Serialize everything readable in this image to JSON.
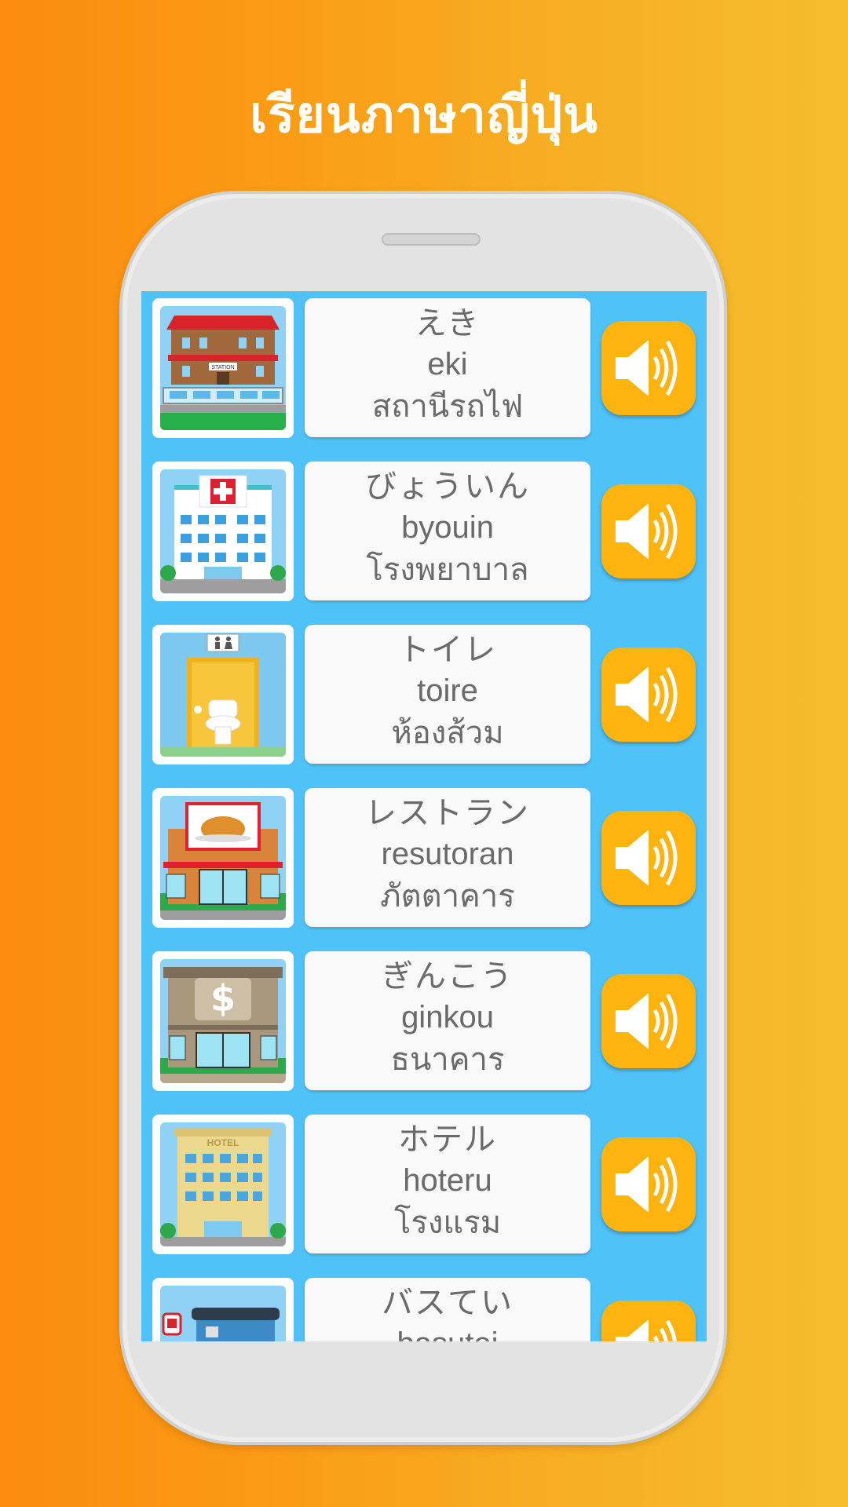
{
  "header": {
    "title": "เรียนภาษาญี่ปุ่น"
  },
  "colors": {
    "accent": "#ffb30f",
    "screen_bg": "#4fc2f7",
    "background": "#fb8c0e"
  },
  "words": [
    {
      "japanese": "えき",
      "romaji": "eki",
      "thai": "สถานีรถไฟ",
      "image": "train-station-icon",
      "sign": "STATION"
    },
    {
      "japanese": "びょういん",
      "romaji": "byouin",
      "thai": "โรงพยาบาล",
      "image": "hospital-icon"
    },
    {
      "japanese": "トイレ",
      "romaji": "toire",
      "thai": "ห้องส้วม",
      "image": "toilet-icon"
    },
    {
      "japanese": "レストラン",
      "romaji": "resutoran",
      "thai": "ภัตตาคาร",
      "image": "restaurant-icon"
    },
    {
      "japanese": "ぎんこう",
      "romaji": "ginkou",
      "thai": "ธนาคาร",
      "image": "bank-icon",
      "sign": "$"
    },
    {
      "japanese": "ホテル",
      "romaji": "hoteru",
      "thai": "โรงแรม",
      "image": "hotel-icon",
      "sign": "HOTEL"
    },
    {
      "japanese": "バスてい",
      "romaji": "basutei",
      "thai": "",
      "image": "bus-stop-icon"
    }
  ]
}
